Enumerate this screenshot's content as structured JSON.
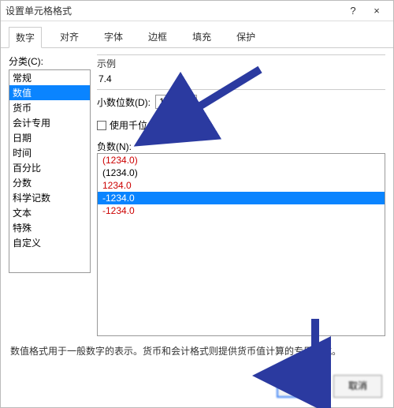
{
  "window": {
    "title": "设置单元格格式",
    "help": "?",
    "close": "×"
  },
  "tabs": {
    "items": [
      "数字",
      "对齐",
      "字体",
      "边框",
      "填充",
      "保护"
    ],
    "activeIndex": 0
  },
  "category": {
    "label": "分类(C):",
    "items": [
      "常规",
      "数值",
      "货币",
      "会计专用",
      "日期",
      "时间",
      "百分比",
      "分数",
      "科学记数",
      "文本",
      "特殊",
      "自定义"
    ],
    "selectedIndex": 1
  },
  "example": {
    "label": "示例",
    "value": "7.4"
  },
  "decimals": {
    "label": "小数位数(D):",
    "value": "1"
  },
  "thousands": {
    "label": "使用千位分隔符(,)(U)"
  },
  "negative": {
    "label": "负数(N):",
    "options": [
      {
        "text": "(1234.0)",
        "style": "red"
      },
      {
        "text": "(1234.0)",
        "style": "black"
      },
      {
        "text": "1234.0",
        "style": "red"
      },
      {
        "text": "-1234.0",
        "style": "black",
        "selected": true
      },
      {
        "text": "-1234.0",
        "style": "red"
      }
    ]
  },
  "hint": "数值格式用于一般数字的表示。货币和会计格式则提供货币值计算的专用格式。",
  "footer": {
    "ok": "确定",
    "cancel": "取消"
  }
}
